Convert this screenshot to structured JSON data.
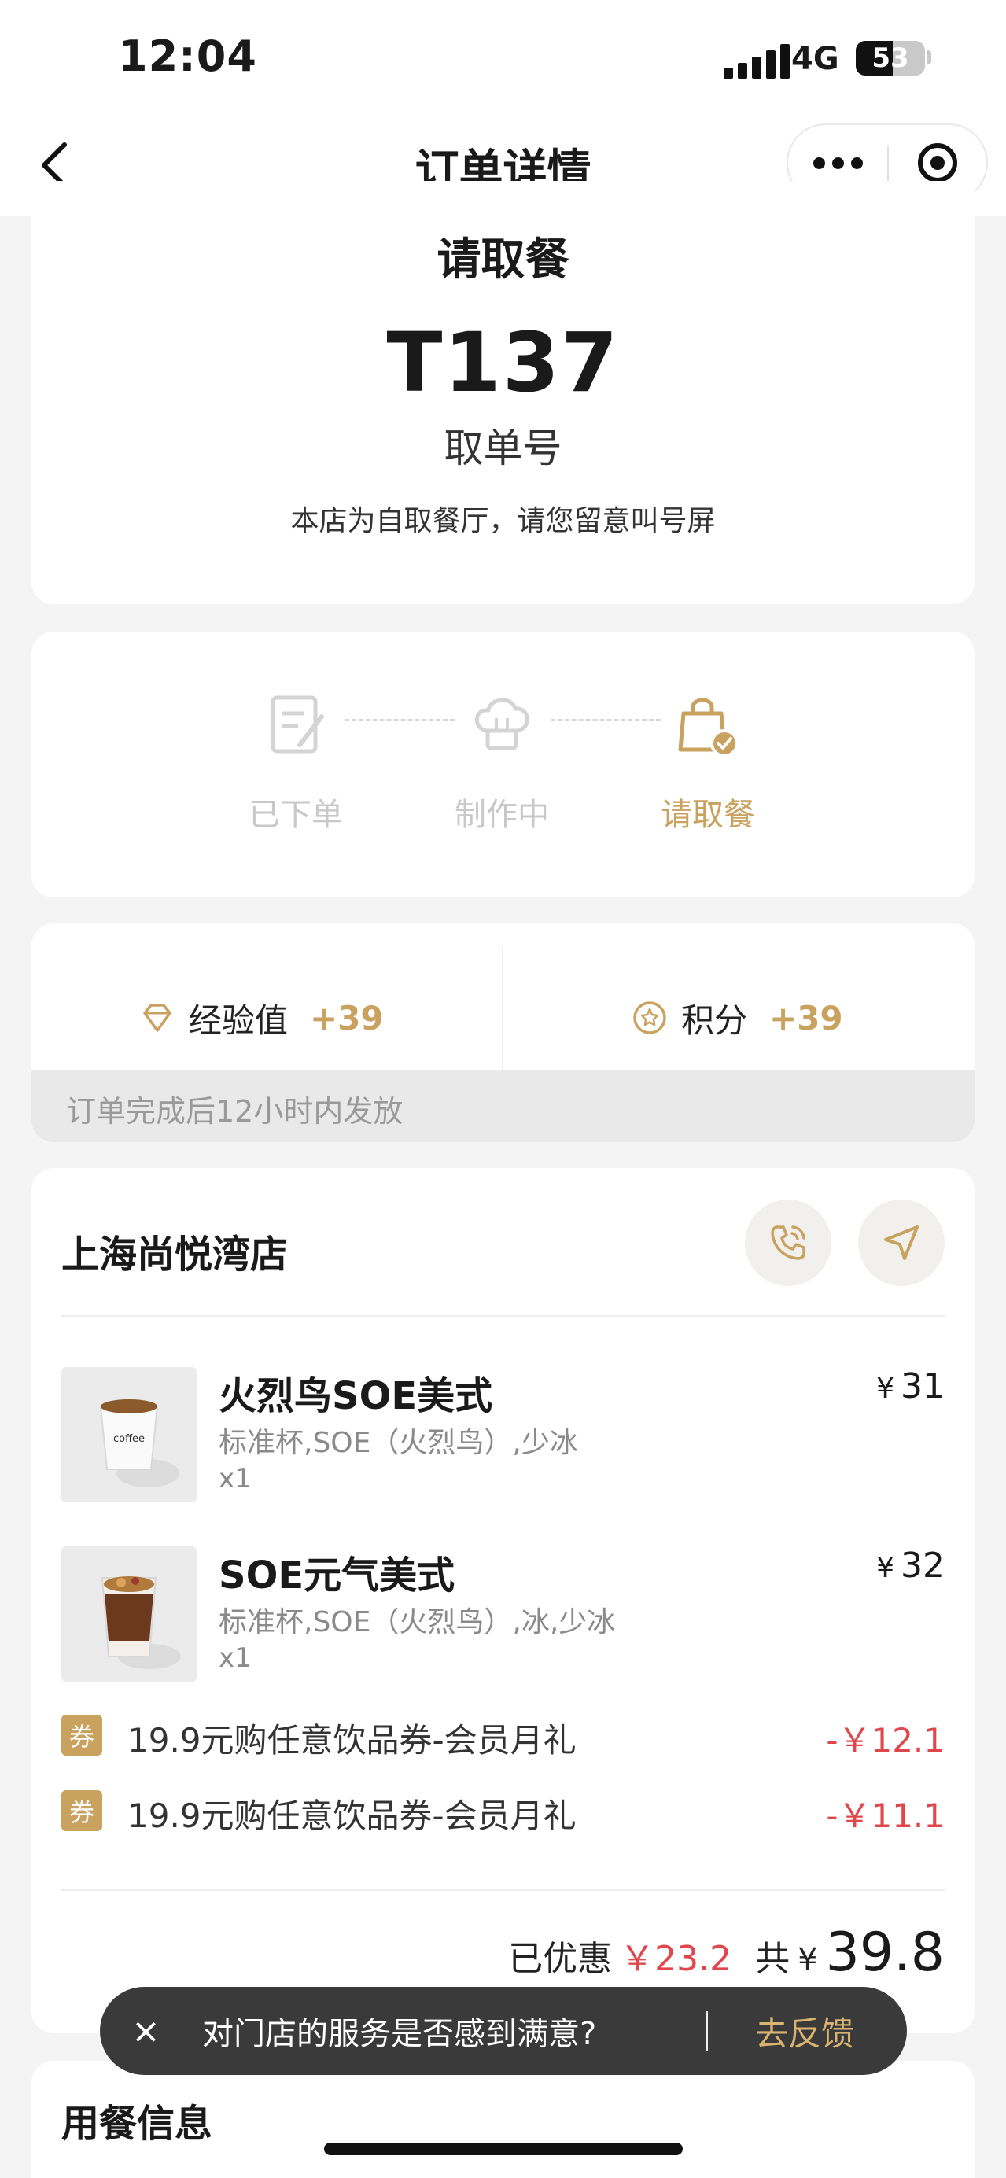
{
  "status_bar": {
    "time": "12:04",
    "network": "4G",
    "battery": "53"
  },
  "nav": {
    "title": "订单详情"
  },
  "pickup": {
    "title": "请取餐",
    "number": "T137",
    "label": "取单号",
    "note": "本店为自取餐厅，请您留意叫号屏"
  },
  "progress": {
    "steps": [
      {
        "label": "已下单",
        "icon": "order-note-icon",
        "state": "done"
      },
      {
        "label": "制作中",
        "icon": "chef-hat-icon",
        "state": "done"
      },
      {
        "label": "请取餐",
        "icon": "shopping-bag-check-icon",
        "state": "active"
      }
    ]
  },
  "rewards": {
    "exp_label": "经验值",
    "exp_value": "+39",
    "points_label": "积分",
    "points_value": "+39",
    "note": "订单完成后12小时内发放"
  },
  "store": {
    "name": "上海尚悦湾店",
    "items": [
      {
        "name": "火烈鸟SOE美式",
        "options": "标准杯,SOE（火烈鸟）,少冰",
        "qty": "x1",
        "currency": "¥",
        "price": "31"
      },
      {
        "name": "SOE元气美式",
        "options": "标准杯,SOE（火烈鸟）,冰,少冰",
        "qty": "x1",
        "currency": "¥",
        "price": "32"
      }
    ],
    "coupons": [
      {
        "tag": "券",
        "name": "19.9元购任意饮品券-会员月礼",
        "amount": "-￥12.1"
      },
      {
        "tag": "券",
        "name": "19.9元购任意饮品券-会员月礼",
        "amount": "-￥11.1"
      }
    ],
    "discount_label": "已优惠",
    "discount_value": "￥23.2",
    "total_label": "共",
    "total_currency": "¥",
    "total_value": "39.8"
  },
  "dining_info": {
    "title": "用餐信息"
  },
  "toast": {
    "close": "×",
    "message": "对门店的服务是否感到满意?",
    "action": "去反馈"
  },
  "colors": {
    "gold": "#c9a260",
    "red": "#e0474c",
    "background": "#f4f4f4"
  }
}
